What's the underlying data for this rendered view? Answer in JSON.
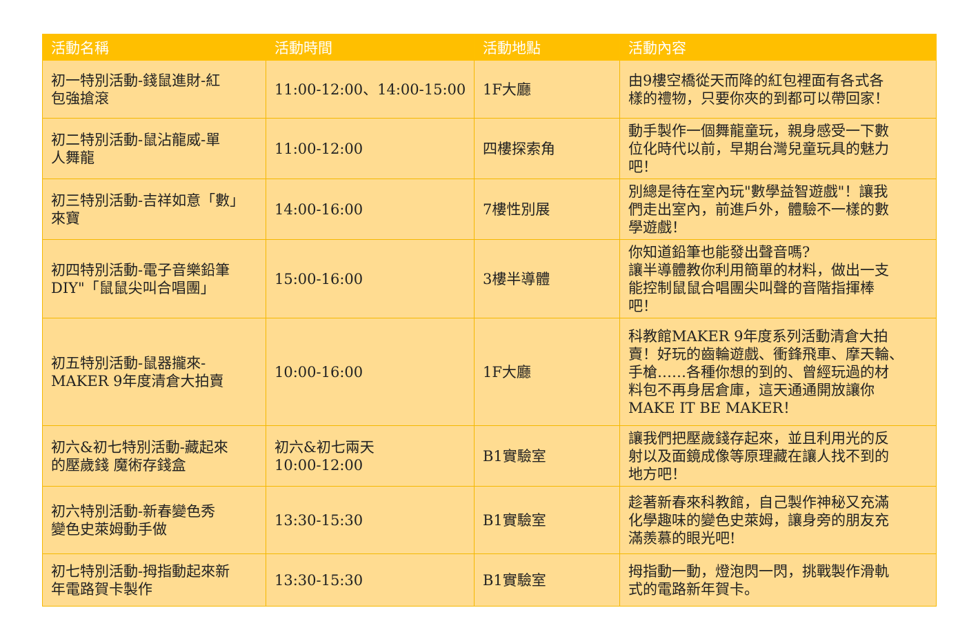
{
  "headers": [
    "活動名稱",
    "活動時間",
    "活動地點",
    "活動內容"
  ],
  "rows": [
    {
      "name": "初一特別活動-錢鼠進財-紅\n包強搶滾",
      "time": "11:00-12:00、14:00-15:00",
      "place": "1F大廳",
      "desc": "由9樓空橋從天而降的紅包裡面有各式各\n樣的禮物，只要你夾的到都可以帶回家！"
    },
    {
      "name": "初二特別活動-鼠沾龍威-單\n人舞龍",
      "time": "11:00-12:00",
      "place": "四樓探索角",
      "desc": "動手製作一個舞龍童玩，親身感受一下數\n位化時代以前，早期台灣兒童玩具的魅力\n吧！"
    },
    {
      "name": "初三特別活動-吉祥如意「數」\n來寶",
      "time": "14:00-16:00",
      "place": "7樓性別展",
      "desc": "別總是待在室內玩\"數學益智遊戲\"！讓我\n們走出室內，前進戶外，體驗不一樣的數\n學遊戲！"
    },
    {
      "name": "初四特別活動-電子音樂鉛筆\nDIY\"「鼠鼠尖叫合唱團」",
      "time": "15:00-16:00",
      "place": "3樓半導體",
      "desc": "你知道鉛筆也能發出聲音嗎?\n讓半導體教你利用簡單的材料，做出一支\n能控制鼠鼠合唱團尖叫聲的音階指揮棒\n吧！"
    },
    {
      "name": "初五特別活動-鼠器攏來-\nMAKER 9年度清倉大拍賣",
      "time": "10:00-16:00",
      "place": "1F大廳",
      "desc": "科教館MAKER 9年度系列活動清倉大拍\n賣！好玩的齒輪遊戲、衝鋒飛車、摩天輪、\n手槍……各種你想的到的、曾經玩過的材\n料包不再身居倉庫，這天通通開放讓你\nMAKE IT BE MAKER！"
    },
    {
      "name": "初六&初七特別活動-藏起來\n的壓歲錢 魔術存錢盒",
      "time": "初六&初七兩天\n10:00-12:00",
      "place": "B1實驗室",
      "desc": "讓我們把壓歲錢存起來，並且利用光的反\n射以及面鏡成像等原理藏在讓人找不到的\n地方吧！"
    },
    {
      "name": "初六特別活動-新春變色秀\n變色史萊姆動手做",
      "time": "13:30-15:30",
      "place": "B1實驗室",
      "desc": "趁著新春來科教館，自己製作神秘又充滿\n化學趣味的變色史萊姆，讓身旁的朋友充\n滿羨慕的眼光吧!"
    },
    {
      "name": "初七特別活動-拇指動起來新\n年電路賀卡製作",
      "time": "13:30-15:30",
      "place": "B1實驗室",
      "desc": "拇指動一動，燈泡閃一閃，挑戰製作滑軌\n式的電路新年賀卡。"
    }
  ]
}
